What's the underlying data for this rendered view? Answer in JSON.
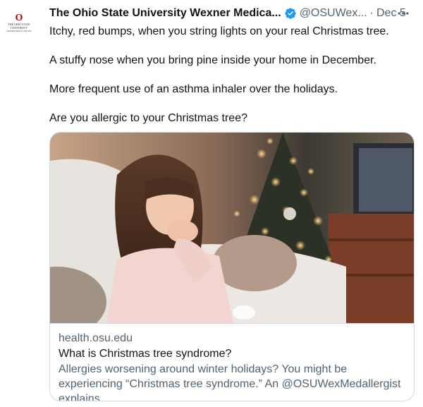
{
  "tweet": {
    "author": {
      "display_name": "The Ohio State University Wexner Medica...",
      "handle": "@OSUWex...",
      "verified": true,
      "avatar_lines": [
        "THE OHIO STATE",
        "UNIVERSITY",
        "WEXNER MEDICAL CENTER"
      ],
      "avatar_mark": "O",
      "brand_color": "#bb0000"
    },
    "separator": "·",
    "date": "Dec 5",
    "more_icon": "more-horizontal-icon",
    "paragraphs": [
      "Itchy, red bumps, when you string lights on your real Christmas tree.",
      "A stuffy nose when you bring pine inside your home in December.",
      "More frequent use of an asthma inhaler over the holidays.",
      "Are you allergic to your Christmas tree?"
    ],
    "card": {
      "image_icon": "photo-girl-coughing-christmas-tree",
      "domain": "health.osu.edu",
      "title": "What is Christmas tree syndrome?",
      "description": "Allergies worsening around winter holidays? You might be experiencing “Christmas tree syndrome.” An @OSUWexMedallergist explains."
    }
  },
  "colors": {
    "text_primary": "#0f1419",
    "text_secondary": "#536471",
    "verified_blue": "#1d9bf0",
    "border": "#cfd9de"
  }
}
